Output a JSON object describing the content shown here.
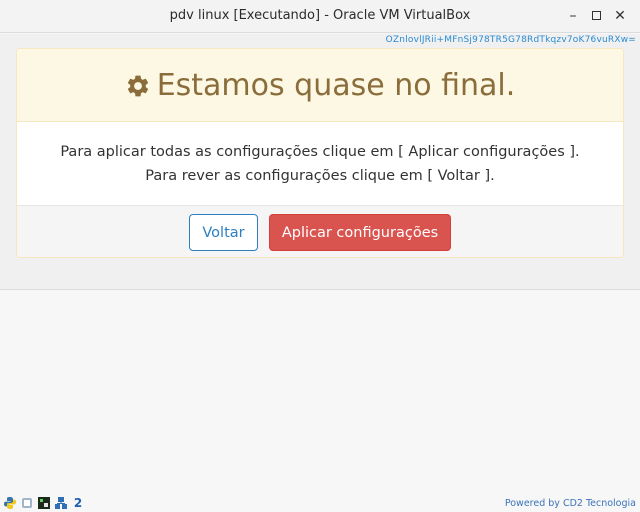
{
  "window": {
    "title": "pdv linux [Executando] - Oracle VM VirtualBox",
    "minimize_icon": "minimize-icon",
    "maximize_icon": "maximize-icon",
    "close_icon": "close-icon"
  },
  "guest": {
    "token": "OZnlovlJRii+MFnSj978TR5G78RdTkqzv7oK76vuRXw=",
    "card": {
      "icon": "gear-icon",
      "heading": "Estamos quase no final.",
      "line1": "Para aplicar todas as configurações clique em [ Aplicar configurações ].",
      "line2": "Para rever as configurações clique em [ Voltar ].",
      "back_label": "Voltar",
      "apply_label": "Aplicar configurações"
    },
    "footer": {
      "powered_by": "Powered by CD2 Tecnologia",
      "tray_icons": [
        "python-icon",
        "app-icon",
        "monitor-icon",
        "network-icon",
        "number-2-icon"
      ],
      "tray_number": "2"
    }
  },
  "colors": {
    "heading": "#8a6d3b",
    "header_bg": "#fcf8e3",
    "apply_bg": "#d9534f",
    "back_border": "#2e7fbf",
    "link": "#3b73b9"
  }
}
